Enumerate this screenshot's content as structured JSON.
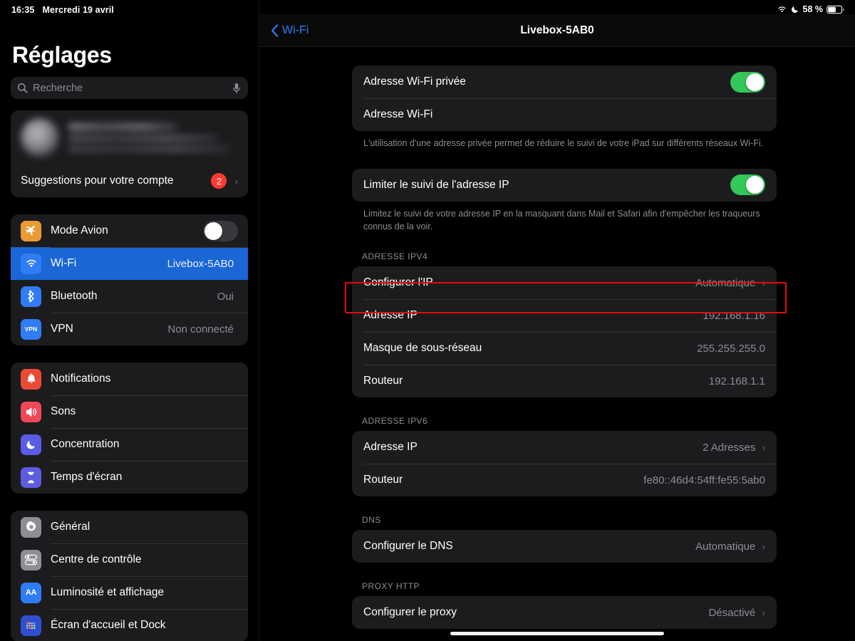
{
  "status_bar": {
    "time": "16:35",
    "date": "Mercredi 19 avril",
    "battery_percent": "58 %",
    "wifi_icon": "wifi-icon",
    "dnd_icon": "moon-icon",
    "battery_icon": "battery-icon"
  },
  "sidebar": {
    "title": "Réglages",
    "search": {
      "placeholder": "Recherche",
      "icon": "search-icon",
      "mic_icon": "microphone-icon"
    },
    "account": {
      "blurred": true,
      "suggestions_label": "Suggestions pour votre compte",
      "suggestions_badge": "2",
      "chevron": "›"
    },
    "groups": [
      {
        "items": [
          {
            "label": "Mode Avion",
            "icon": "airplane-icon",
            "icon_color": "#ea9b36",
            "control": "toggle",
            "toggle_on": false
          },
          {
            "label": "Wi-Fi",
            "icon": "wifi-icon",
            "icon_color": "#2f7cf6",
            "value": "Livebox-5AB0",
            "selected": true
          },
          {
            "label": "Bluetooth",
            "icon": "bluetooth-icon",
            "icon_color": "#2f7cf6",
            "value": "Oui"
          },
          {
            "label": "VPN",
            "icon": "vpn-icon",
            "icon_color": "#2f7cf6",
            "value": "Non connecté"
          }
        ]
      },
      {
        "items": [
          {
            "label": "Notifications",
            "icon": "bell-icon",
            "icon_color": "#eb4b35"
          },
          {
            "label": "Sons",
            "icon": "speaker-icon",
            "icon_color": "#ef4858"
          },
          {
            "label": "Concentration",
            "icon": "moon-icon",
            "icon_color": "#5a5ce6"
          },
          {
            "label": "Temps d'écran",
            "icon": "hourglass-icon",
            "icon_color": "#5d5ce0"
          }
        ]
      },
      {
        "items": [
          {
            "label": "Général",
            "icon": "gear-icon",
            "icon_color": "#8e8e93"
          },
          {
            "label": "Centre de contrôle",
            "icon": "sliders-icon",
            "icon_color": "#8e8e93"
          },
          {
            "label": "Luminosité et affichage",
            "icon": "aa-icon",
            "icon_color": "#2f7cf6"
          },
          {
            "label": "Écran d'accueil et Dock",
            "icon": "home-screen-icon",
            "icon_color": "#2f4fd0"
          }
        ]
      }
    ]
  },
  "detail": {
    "back_label": "Wi-Fi",
    "back_icon": "chevron-left-icon",
    "title": "Livebox-5AB0",
    "sections": [
      {
        "header": "",
        "rows": [
          {
            "label": "Adresse Wi-Fi privée",
            "control": "toggle",
            "toggle_on": true
          },
          {
            "label": "Adresse Wi-Fi",
            "value": ""
          }
        ],
        "footnote": "L'utilisation d'une adresse privée permet de réduire le suivi de votre iPad sur différents réseaux Wi-Fi."
      },
      {
        "header": "",
        "rows": [
          {
            "label": "Limiter le suivi de l'adresse IP",
            "control": "toggle",
            "toggle_on": true
          }
        ],
        "footnote": "Limitez le suivi de votre adresse IP en la masquant dans Mail et Safari afin d'empêcher les traqueurs connus de la voir."
      },
      {
        "header": "ADRESSE IPV4",
        "rows": [
          {
            "label": "Configurer l'IP",
            "value": "Automatique",
            "chevron": "›"
          },
          {
            "label": "Adresse IP",
            "value": "192.168.1.16",
            "highlighted": true
          },
          {
            "label": "Masque de sous-réseau",
            "value": "255.255.255.0"
          },
          {
            "label": "Routeur",
            "value": "192.168.1.1"
          }
        ],
        "footnote": ""
      },
      {
        "header": "ADRESSE IPV6",
        "rows": [
          {
            "label": "Adresse IP",
            "value": "2 Adresses",
            "chevron": "›"
          },
          {
            "label": "Routeur",
            "value": "fe80::46d4:54ff:fe55:5ab0"
          }
        ],
        "footnote": ""
      },
      {
        "header": "DNS",
        "rows": [
          {
            "label": "Configurer le DNS",
            "value": "Automatique",
            "chevron": "›"
          }
        ],
        "footnote": ""
      },
      {
        "header": "PROXY HTTP",
        "rows": [
          {
            "label": "Configurer le proxy",
            "value": "Désactivé",
            "chevron": "›"
          }
        ],
        "footnote": ""
      }
    ],
    "highlight_color": "#e50b0b"
  }
}
